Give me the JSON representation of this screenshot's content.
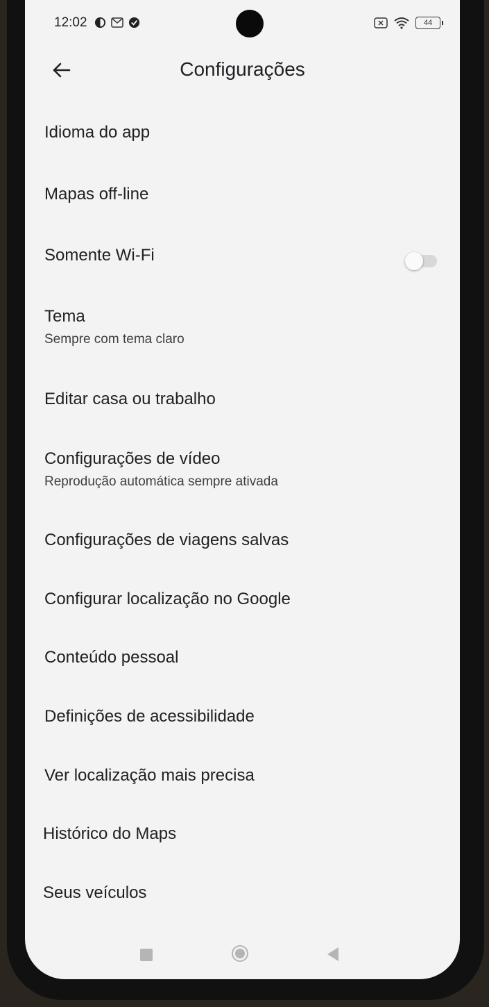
{
  "status_bar": {
    "time": "12:02",
    "battery": "44",
    "icons_left": [
      "data-saver-icon",
      "gmail-icon",
      "check-shield-icon"
    ],
    "icons_right": [
      "sim-off-icon",
      "wifi-icon",
      "battery-icon"
    ]
  },
  "app_bar": {
    "title": "Configurações",
    "back_icon": "arrow-back-icon"
  },
  "settings": {
    "items": [
      {
        "title": "Idioma do app"
      },
      {
        "title": "Mapas off-line"
      },
      {
        "title": "Somente Wi-Fi",
        "toggle": false
      },
      {
        "title": "Tema",
        "subtitle": "Sempre com tema claro"
      },
      {
        "title": "Editar casa ou trabalho"
      },
      {
        "title": "Configurações de vídeo",
        "subtitle": "Reprodução automática sempre ativada"
      },
      {
        "title": "Configurações de viagens salvas"
      },
      {
        "title": "Configurar localização no Google"
      },
      {
        "title": "Conteúdo pessoal"
      },
      {
        "title": "Definições de acessibilidade"
      },
      {
        "title": "Ver localização mais precisa"
      },
      {
        "title": "Histórico do Maps"
      },
      {
        "title": "Seus veículos"
      }
    ]
  },
  "nav_bar": {
    "buttons": [
      "recents-icon",
      "home-icon",
      "back-triangle-icon"
    ]
  }
}
